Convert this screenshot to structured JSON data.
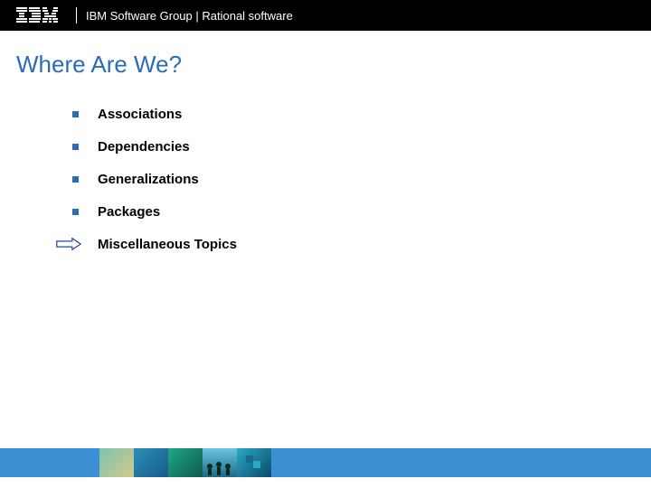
{
  "header": {
    "group_text": "IBM Software Group | Rational software"
  },
  "title": "Where Are We?",
  "items": [
    {
      "label": "Associations",
      "current": false
    },
    {
      "label": "Dependencies",
      "current": false
    },
    {
      "label": "Generalizations",
      "current": false
    },
    {
      "label": "Packages",
      "current": false
    },
    {
      "label": "Miscellaneous Topics",
      "current": true
    }
  ]
}
